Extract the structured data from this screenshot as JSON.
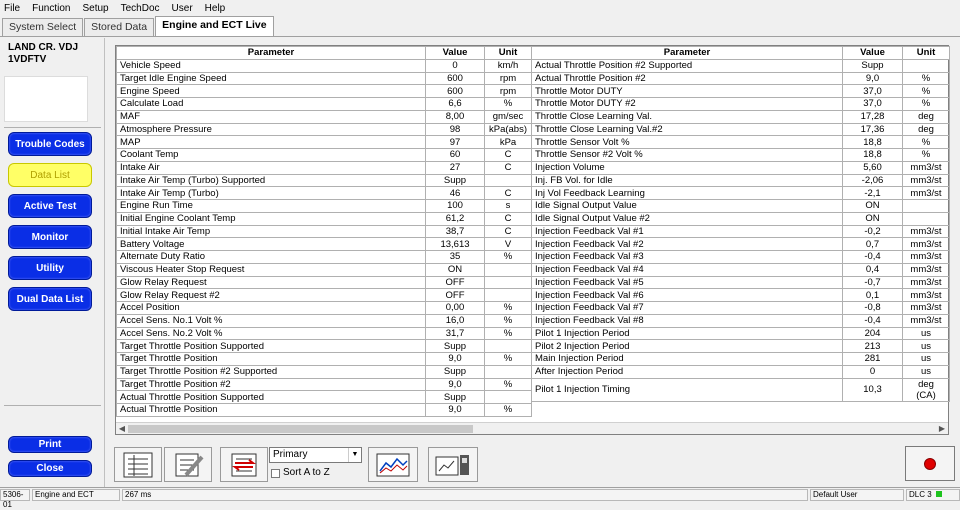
{
  "menu": [
    "File",
    "Function",
    "Setup",
    "TechDoc",
    "User",
    "Help"
  ],
  "tabs": [
    "System Select",
    "Stored Data",
    "Engine and ECT Live"
  ],
  "vehicle": {
    "model": "LAND CR. VDJ",
    "engine": "1VDFTV"
  },
  "nav": {
    "trouble_codes": "Trouble Codes",
    "data_list": "Data List",
    "active_test": "Active Test",
    "monitor": "Monitor",
    "utility": "Utility",
    "dual_data_list": "Dual Data List",
    "print": "Print",
    "close": "Close"
  },
  "table": {
    "headers": {
      "parameter": "Parameter",
      "value": "Value",
      "unit": "Unit"
    },
    "left": [
      [
        "Vehicle Speed",
        "0",
        "km/h"
      ],
      [
        "Target Idle Engine Speed",
        "600",
        "rpm"
      ],
      [
        "Engine Speed",
        "600",
        "rpm"
      ],
      [
        "Calculate Load",
        "6,6",
        "%"
      ],
      [
        "MAF",
        "8,00",
        "gm/sec"
      ],
      [
        "Atmosphere Pressure",
        "98",
        "kPa(abs)"
      ],
      [
        "MAP",
        "97",
        "kPa"
      ],
      [
        "Coolant Temp",
        "60",
        "C"
      ],
      [
        "Intake Air",
        "27",
        "C"
      ],
      [
        "Intake Air Temp (Turbo) Supported",
        "Supp",
        ""
      ],
      [
        "Intake Air Temp (Turbo)",
        "46",
        "C"
      ],
      [
        "Engine Run Time",
        "100",
        "s"
      ],
      [
        "Initial Engine Coolant Temp",
        "61,2",
        "C"
      ],
      [
        "Initial Intake Air Temp",
        "38,7",
        "C"
      ],
      [
        "Battery Voltage",
        "13,613",
        "V"
      ],
      [
        "Alternate Duty Ratio",
        "35",
        "%"
      ],
      [
        "Viscous Heater Stop Request",
        "ON",
        ""
      ],
      [
        "Glow Relay Request",
        "OFF",
        ""
      ],
      [
        "Glow Relay Request #2",
        "OFF",
        ""
      ],
      [
        "Accel Position",
        "0,00",
        "%"
      ],
      [
        "Accel Sens. No.1 Volt %",
        "16,0",
        "%"
      ],
      [
        "Accel Sens. No.2 Volt %",
        "31,7",
        "%"
      ],
      [
        "Target Throttle Position Supported",
        "Supp",
        ""
      ],
      [
        "Target Throttle Position",
        "9,0",
        "%"
      ],
      [
        "Target Throttle Position #2 Supported",
        "Supp",
        ""
      ],
      [
        "Target Throttle Position #2",
        "9,0",
        "%"
      ],
      [
        "Actual Throttle Position Supported",
        "Supp",
        ""
      ],
      [
        "Actual Throttle Position",
        "9,0",
        "%"
      ]
    ],
    "right": [
      [
        "Actual Throttle Position #2 Supported",
        "Supp",
        ""
      ],
      [
        "Actual Throttle Position #2",
        "9,0",
        "%"
      ],
      [
        "Throttle Motor DUTY",
        "37,0",
        "%"
      ],
      [
        "Throttle Motor DUTY #2",
        "37,0",
        "%"
      ],
      [
        "Throttle Close Learning Val.",
        "17,28",
        "deg"
      ],
      [
        "Throttle Close Learning Val.#2",
        "17,36",
        "deg"
      ],
      [
        "Throttle Sensor Volt %",
        "18,8",
        "%"
      ],
      [
        "Throttle Sensor #2 Volt %",
        "18,8",
        "%"
      ],
      [
        "Injection Volume",
        "5,60",
        "mm3/st"
      ],
      [
        "Inj. FB Vol. for Idle",
        "-2,06",
        "mm3/st"
      ],
      [
        "Inj Vol Feedback Learning",
        "-2,1",
        "mm3/st"
      ],
      [
        "Idle Signal Output Value",
        "ON",
        ""
      ],
      [
        "Idle Signal Output Value #2",
        "ON",
        ""
      ],
      [
        "Injection Feedback Val #1",
        "-0,2",
        "mm3/st"
      ],
      [
        "Injection Feedback Val #2",
        "0,7",
        "mm3/st"
      ],
      [
        "Injection Feedback Val #3",
        "-0,4",
        "mm3/st"
      ],
      [
        "Injection Feedback Val #4",
        "0,4",
        "mm3/st"
      ],
      [
        "Injection Feedback Val #5",
        "-0,7",
        "mm3/st"
      ],
      [
        "Injection Feedback Val #6",
        "0,1",
        "mm3/st"
      ],
      [
        "Injection Feedback Val #7",
        "-0,8",
        "mm3/st"
      ],
      [
        "Injection Feedback Val #8",
        "-0,4",
        "mm3/st"
      ],
      [
        "Pilot 1 Injection Period",
        "204",
        "us"
      ],
      [
        "Pilot 2 Injection Period",
        "213",
        "us"
      ],
      [
        "Main Injection Period",
        "281",
        "us"
      ],
      [
        "After Injection Period",
        "0",
        "us"
      ],
      [
        "Pilot 1 Injection Timing",
        "10,3",
        "deg\n(CA)"
      ]
    ]
  },
  "toolbar": {
    "select_value": "Primary",
    "sort_label": "Sort A to Z"
  },
  "status": {
    "code": "5306-01",
    "system": "Engine and ECT",
    "time": "267 ms",
    "user": "Default User",
    "dlc": "DLC 3"
  },
  "colors": {
    "nav_blue": "#0a2ee6",
    "active_yellow": "#ffff66",
    "record_red": "#e00000",
    "status_green": "#1ec31e"
  }
}
